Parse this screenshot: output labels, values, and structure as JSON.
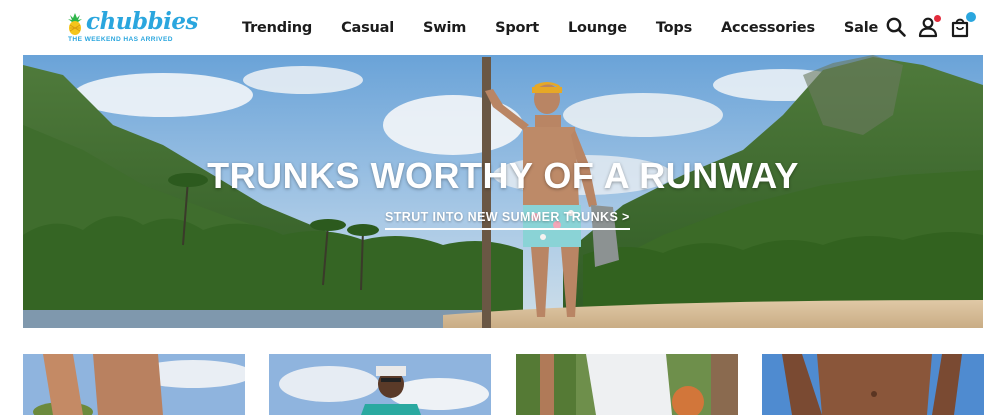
{
  "brand": {
    "name": "chubbies",
    "tagline": "THE WEEKEND HAS ARRIVED",
    "color": "#2aa6de"
  },
  "nav": {
    "items": [
      {
        "label": "Trending"
      },
      {
        "label": "Casual"
      },
      {
        "label": "Swim"
      },
      {
        "label": "Sport"
      },
      {
        "label": "Lounge"
      },
      {
        "label": "Tops"
      },
      {
        "label": "Accessories"
      },
      {
        "label": "Sale"
      }
    ]
  },
  "header_icons": [
    {
      "name": "search-icon"
    },
    {
      "name": "account-icon",
      "badge_color": "#e32b3c"
    },
    {
      "name": "cart-icon",
      "badge_color": "#2aa6de"
    }
  ],
  "hero": {
    "title": "TRUNKS WORTHY OF A RUNWAY",
    "cta": "STRUT INTO NEW SUMMER TRUNKS >"
  },
  "product_tiles": [
    {
      "name": "tile-1"
    },
    {
      "name": "tile-2"
    },
    {
      "name": "tile-3"
    },
    {
      "name": "tile-4"
    }
  ]
}
